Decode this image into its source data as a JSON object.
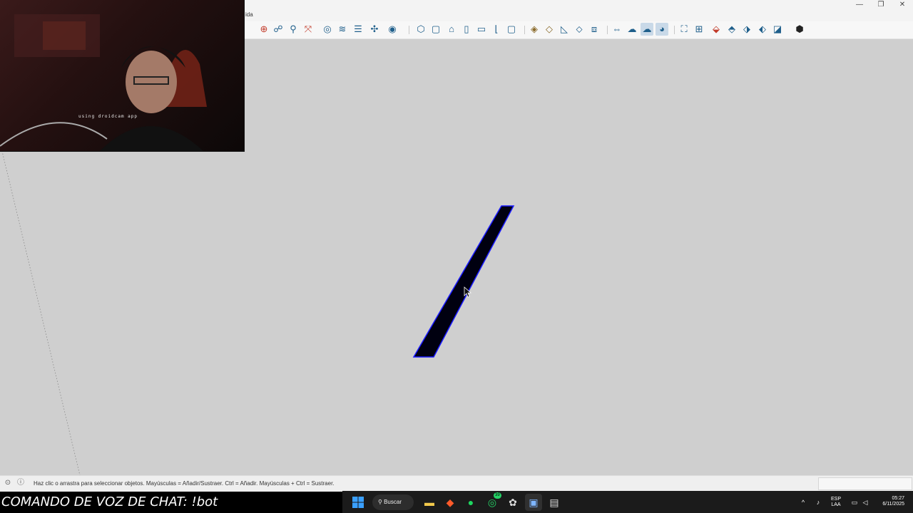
{
  "window": {
    "menu_fragment": "ida",
    "controls": [
      "—",
      "❐",
      "✕"
    ]
  },
  "toolbar": {
    "icons": [
      "orbit-icon",
      "section-plane-icon",
      "paint-icon",
      "zoom-icon",
      "zoom-extents-icon",
      "look-around-icon",
      "walk-icon",
      "position-camera-icon",
      "axes-icon",
      "circle-menu-icon",
      "iso-view-icon",
      "top-view-icon",
      "front-view-icon",
      "right-view-icon",
      "back-view-icon",
      "left-view-icon",
      "bottom-view-icon",
      "xray-icon",
      "back-edges-icon",
      "wireframe-icon",
      "hidden-line-icon",
      "shaded-icon",
      "shaded-textures-icon",
      "monochrome-icon",
      "section-fill-icon",
      "section-cuts-icon",
      "sandbox-from-contours-icon",
      "sandbox-from-scratch-icon",
      "smoove-icon",
      "stamp-icon",
      "drape-icon",
      "add-detail-icon",
      "flip-edge-icon",
      "extension-icon"
    ]
  },
  "webcam": {
    "watermark": "using droidcam app"
  },
  "viewport": {
    "selected_face_color": "#000010",
    "selected_edge_color": "#1a1aff",
    "axis_color": "#8a8a8a"
  },
  "statusbar": {
    "hint": "Haz clic o arrastra para seleccionar objetos. Mayúsculas = Añadir/Sustraer. Ctrl = Añadir. Mayúsculas + Ctrl = Sustraer.",
    "measurements_value": ""
  },
  "chat_overlay": {
    "text": "COMANDO DE VOZ DE CHAT: !bot"
  },
  "taskbar": {
    "search_label": "Buscar",
    "lang_top": "ESP",
    "lang_bottom": "LAA",
    "time": "05:27",
    "date": "6/11/2025",
    "whatsapp_badge": "39"
  }
}
